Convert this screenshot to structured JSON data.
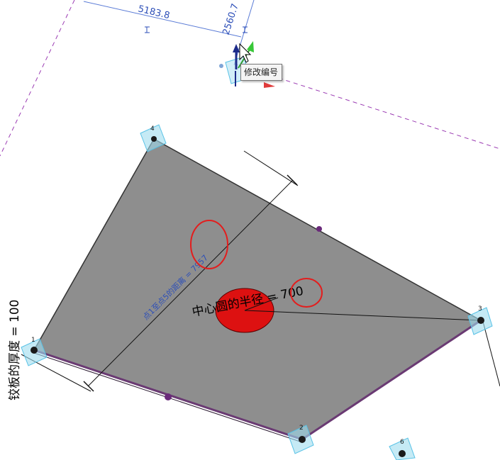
{
  "tooltip": {
    "text": "修改编号"
  },
  "dimensions": {
    "top_a": "5183.8",
    "top_b": "2560.7",
    "diagonal": "点1至点5的距离 = 7957"
  },
  "labels": {
    "thickness": "铰板的厚度 = 100",
    "radius_prefix": "中心圆的半径 = ",
    "radius_value": "700"
  },
  "points": [
    "1",
    "2",
    "3",
    "4",
    "6"
  ],
  "colors": {
    "plate": "#8e8e8e",
    "plate_edge": "#6a3a73",
    "circle": "#dd1111",
    "highlight": "#e31d1d",
    "dimension_blue": "#2d4fb8",
    "ref_line": "#9b3cb3",
    "marker": "#58c2e6"
  },
  "icons": [
    "move-gizmo-icon",
    "cursor-icon"
  ]
}
